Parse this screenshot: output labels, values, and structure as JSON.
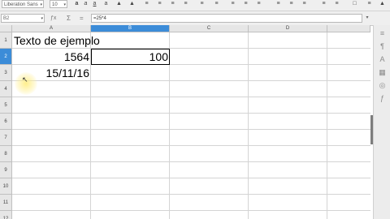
{
  "toolbar": {
    "font_name": "Liberation Sans",
    "font_size": "10"
  },
  "formula_bar": {
    "name_box": "B2",
    "content": "=25*4",
    "sum_symbol": "Σ",
    "equals_symbol": "="
  },
  "columns": [
    "A",
    "B",
    "C",
    "D"
  ],
  "selected_column": "B",
  "rows": [
    "1",
    "2",
    "3",
    "4",
    "5",
    "6",
    "7",
    "8",
    "9",
    "10",
    "11",
    "12"
  ],
  "selected_row": "2",
  "cells": {
    "A1": "Texto de ejemplo",
    "A2": "1564",
    "B2": "100",
    "A3": "15/11/16"
  },
  "colors": {
    "header_selected": "#3c8cd8",
    "header_bg": "#e6e6e6",
    "grid_line": "#d4d4d4"
  }
}
